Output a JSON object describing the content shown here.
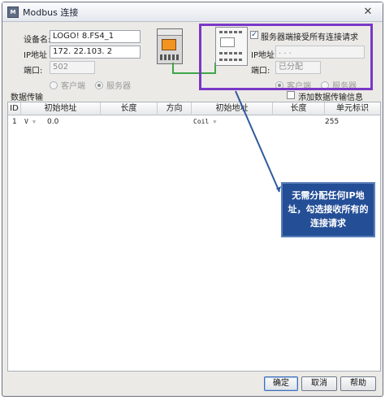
{
  "window": {
    "title": "Modbus 连接",
    "close_label": "✕",
    "app_icon_label": "M"
  },
  "local": {
    "device_name_label": "设备名:",
    "device_name_value": "LOGO! 8.FS4_1",
    "ip_label": "IP地址",
    "ip_value": "172. 22.103.  2",
    "port_label": "端口:",
    "port_value": "502",
    "radio_client": "客户端",
    "radio_server": "服务器"
  },
  "remote": {
    "accept_all_label": "服务器端接受所有连接请求",
    "accept_all_checked": true,
    "ip_label": "IP地址",
    "ip_value": "  .   .   .",
    "port_label": "端口:",
    "port_value": "已分配",
    "radio_client": "客户端",
    "radio_server": "服务器"
  },
  "transfer": {
    "section_label": "数据传输",
    "add_info_label": "添加数据传输信息",
    "columns": [
      "ID",
      "初始地址",
      "长度",
      "方向",
      "初始地址",
      "长度",
      "单元标识"
    ],
    "rows": [
      {
        "id": "1",
        "local_type": "V",
        "local_addr": "0.0",
        "length": "",
        "direction": "",
        "remote_type": "Coil",
        "remote_length": "",
        "unit_id": "255"
      }
    ]
  },
  "buttons": {
    "ok": "确定",
    "cancel": "取消",
    "help": "帮助"
  },
  "callout": {
    "text": "无需分配任何IP地址，勾选接收所有的连接请求"
  },
  "colors": {
    "highlight": "#7a37c8",
    "callout_bg": "#244f97",
    "wire": "#3fa64a",
    "screen": "#f39422"
  }
}
